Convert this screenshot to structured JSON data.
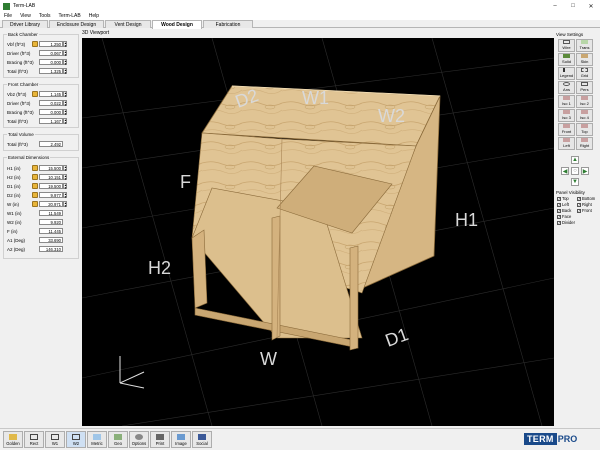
{
  "window": {
    "title": "Term-LAB"
  },
  "menu": [
    "File",
    "View",
    "Tools",
    "Term-LAB",
    "Help"
  ],
  "tabs": [
    {
      "label": "Driver Library",
      "active": false
    },
    {
      "label": "Enclosure Design",
      "active": false
    },
    {
      "label": "Vent Design",
      "active": false
    },
    {
      "label": "Wood Design",
      "active": true
    },
    {
      "label": "Fabrication",
      "active": false
    }
  ],
  "back_chamber": {
    "title": "Back Chamber",
    "rows": [
      {
        "label": "Vbf (ft^3)",
        "value": "1.250",
        "lock": true
      },
      {
        "label": "Driver (ft^3)",
        "value": "0.067",
        "lock": false
      },
      {
        "label": "Bracing (ft^3)",
        "value": "0.000",
        "lock": false
      },
      {
        "label": "Total (ft^3)",
        "value": "1.325",
        "lock": false
      }
    ]
  },
  "front_chamber": {
    "title": "Front Chamber",
    "rows": [
      {
        "label": "Vb2 (ft^3)",
        "value": "1.145",
        "lock": true
      },
      {
        "label": "Driver (ft^3)",
        "value": "0.022",
        "lock": false
      },
      {
        "label": "Bracing (ft^3)",
        "value": "0.000",
        "lock": false
      },
      {
        "label": "Total (ft^3)",
        "value": "1.167",
        "lock": false
      }
    ]
  },
  "total_volume": {
    "title": "Total Volume",
    "rows": [
      {
        "label": "Total (ft^3)",
        "value": "2.492"
      }
    ]
  },
  "external_dimensions": {
    "title": "External Dimensions",
    "rows": [
      {
        "label": "H1 (in)",
        "value": "15.500",
        "lock": true
      },
      {
        "label": "H2 (in)",
        "value": "10.151",
        "lock": true
      },
      {
        "label": "D1 (in)",
        "value": "19.500",
        "lock": true
      },
      {
        "label": "D2 (in)",
        "value": "9.977",
        "lock": true
      },
      {
        "label": "W (in)",
        "value": "20.971",
        "lock": true
      },
      {
        "label": "W1 (in)",
        "value": "11.549",
        "lock": false
      },
      {
        "label": "W2 (in)",
        "value": "9.920",
        "lock": false
      },
      {
        "label": "F (in)",
        "value": "11.445",
        "lock": false
      },
      {
        "label": "A1 (Deg)",
        "value": "33.690",
        "lock": false
      },
      {
        "label": "A2 (Deg)",
        "value": "146.310",
        "lock": false
      }
    ]
  },
  "viewport": {
    "title": "3D Viewport",
    "labels": {
      "D2": "D2",
      "W1": "W1",
      "W2": "W2",
      "F": "F",
      "H1": "H1",
      "H2": "H2",
      "W": "W",
      "D1": "D1"
    }
  },
  "view_settings": {
    "title": "View Settings",
    "buttons": [
      "Wire",
      "Trans",
      "Solid",
      "Skin",
      "Legend",
      "Grid",
      "Ans",
      "Pers",
      "Iso 1",
      "Iso 2",
      "Iso 3",
      "Iso 4",
      "Front",
      "Top",
      "Left",
      "Right"
    ]
  },
  "panel_visibility": {
    "title": "Panel Visibility",
    "items": [
      {
        "label": "Top",
        "checked": true
      },
      {
        "label": "Bottom",
        "checked": true
      },
      {
        "label": "Left",
        "checked": true
      },
      {
        "label": "Right",
        "checked": true
      },
      {
        "label": "Back",
        "checked": true
      },
      {
        "label": "Front",
        "checked": true
      },
      {
        "label": "Face",
        "checked": true
      },
      {
        "label": "Divider",
        "checked": true
      }
    ]
  },
  "bottom_toolbar": [
    "Golden",
    "Rect",
    "W1",
    "W2",
    "Metric",
    "Geo",
    "Options",
    "Print",
    "Image",
    "Social"
  ],
  "logo": {
    "part1": "TERM",
    "part2": "PRO"
  }
}
